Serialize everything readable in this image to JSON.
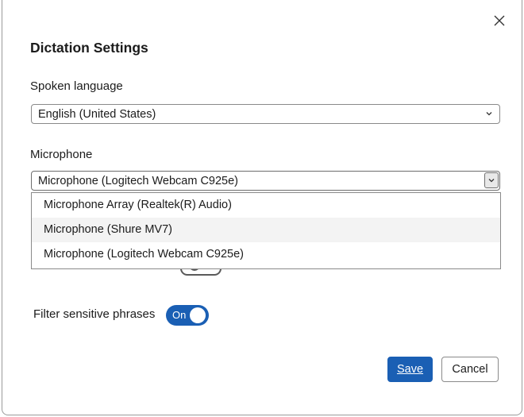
{
  "dialog": {
    "title": "Dictation Settings",
    "close_icon": "close-icon"
  },
  "language": {
    "label": "Spoken language",
    "selected": "English (United States)"
  },
  "microphone": {
    "label": "Microphone",
    "selected": "Microphone (Logitech Webcam C925e)",
    "dropdown_open": true,
    "options": [
      "Microphone Array (Realtek(R) Audio)",
      "Microphone (Shure MV7)",
      "Microphone (Logitech Webcam C925e)"
    ],
    "hovered_option_index": 1
  },
  "filter": {
    "label": "Filter sensitive phrases",
    "toggle_text": "On",
    "on": true
  },
  "buttons": {
    "save": "Save",
    "cancel": "Cancel"
  },
  "colors": {
    "accent": "#1a5fb4"
  }
}
